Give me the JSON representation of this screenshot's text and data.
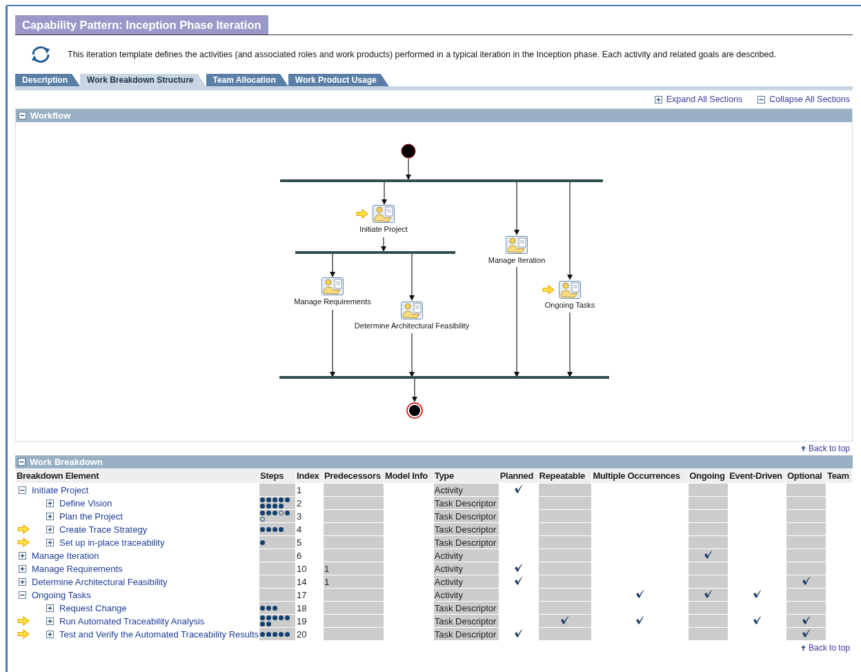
{
  "title": "Capability Pattern: Inception Phase Iteration",
  "description": "This iteration template defines the activities (and associated roles and work products) performed in a typical iteration in the Inception phase. Each activity and related goals are described.",
  "tabs": [
    {
      "label": "Description",
      "selected": false
    },
    {
      "label": "Work Breakdown Structure",
      "selected": true
    },
    {
      "label": "Team Allocation",
      "selected": false
    },
    {
      "label": "Work Product Usage",
      "selected": false
    }
  ],
  "section_links": [
    {
      "kind": "expand",
      "label": "Expand All Sections"
    },
    {
      "kind": "collapse",
      "label": "Collapse All Sections"
    }
  ],
  "workflow": {
    "title": "Workflow",
    "expanded": true,
    "nodes": [
      {
        "label": "Initiate Project",
        "highlighted": true
      },
      {
        "label": "Manage Iteration",
        "highlighted": false
      },
      {
        "label": "Ongoing Tasks",
        "highlighted": true
      },
      {
        "label": "Manage Requirements",
        "highlighted": false
      },
      {
        "label": "Determine Architectural Feasibility",
        "highlighted": false
      }
    ],
    "back_to_top": "Back to top"
  },
  "work_breakdown": {
    "title": "Work Breakdown",
    "expanded": true,
    "columns": [
      "Breakdown Element",
      "Steps",
      "Index",
      "Predecessors",
      "Model Info",
      "Type",
      "Planned",
      "Repeatable",
      "Multiple Occurrences",
      "Ongoing",
      "Event-Driven",
      "Optional",
      "Team"
    ],
    "rows": [
      {
        "name": "Initiate Project",
        "expanded": true,
        "highlighted": false,
        "steps": [],
        "index": "1",
        "type": "Activity",
        "planned": true,
        "repeatable": false,
        "multiple": false,
        "ongoing": false,
        "event_driven": false,
        "optional": false,
        "children": [
          {
            "name": "Define Vision",
            "expanded": false,
            "highlighted": false,
            "steps": [
              {
                "filled": true
              },
              {
                "filled": true
              },
              {
                "filled": true
              },
              {
                "filled": true
              },
              {
                "filled": true
              },
              {
                "filled": true
              },
              {
                "filled": true
              },
              {
                "filled": true
              },
              {
                "filled": true
              }
            ],
            "index": "2",
            "type": "Task Descriptor",
            "planned": false,
            "repeatable": false,
            "multiple": false,
            "ongoing": false,
            "event_driven": false,
            "optional": false
          },
          {
            "name": "Plan the Project",
            "expanded": false,
            "highlighted": false,
            "steps": [
              {
                "filled": true
              },
              {
                "filled": true
              },
              {
                "filled": true
              },
              {
                "filled": false
              },
              {
                "filled": true
              },
              {
                "filled": false
              }
            ],
            "index": "3",
            "type": "Task Descriptor",
            "planned": false,
            "repeatable": false,
            "multiple": false,
            "ongoing": false,
            "event_driven": false,
            "optional": false
          },
          {
            "name": "Create Trace Strategy",
            "expanded": false,
            "highlighted": true,
            "steps": [
              {
                "filled": true
              },
              {
                "filled": true
              },
              {
                "filled": true
              },
              {
                "filled": true
              }
            ],
            "index": "4",
            "type": "Task Descriptor",
            "planned": false,
            "repeatable": false,
            "multiple": false,
            "ongoing": false,
            "event_driven": false,
            "optional": false
          },
          {
            "name": "Set up in-place traceability",
            "expanded": false,
            "highlighted": true,
            "steps": [
              {
                "filled": true
              }
            ],
            "index": "5",
            "type": "Task Descriptor",
            "planned": false,
            "repeatable": false,
            "multiple": false,
            "ongoing": false,
            "event_driven": false,
            "optional": false
          }
        ]
      },
      {
        "name": "Manage Iteration",
        "expanded": false,
        "highlighted": false,
        "steps": [],
        "index": "6",
        "type": "Activity",
        "planned": false,
        "repeatable": false,
        "multiple": false,
        "ongoing": true,
        "event_driven": false,
        "optional": false
      },
      {
        "name": "Manage Requirements",
        "expanded": false,
        "highlighted": false,
        "steps": [],
        "index": "10",
        "predecessors": "1",
        "type": "Activity",
        "planned": true,
        "repeatable": false,
        "multiple": false,
        "ongoing": false,
        "event_driven": false,
        "optional": false
      },
      {
        "name": "Determine Architectural Feasibility",
        "expanded": false,
        "highlighted": false,
        "steps": [],
        "index": "14",
        "predecessors": "1",
        "type": "Activity",
        "planned": true,
        "repeatable": false,
        "multiple": false,
        "ongoing": false,
        "event_driven": false,
        "optional": true
      },
      {
        "name": "Ongoing Tasks",
        "expanded": true,
        "highlighted": false,
        "steps": [],
        "index": "17",
        "type": "Activity",
        "planned": false,
        "repeatable": false,
        "multiple": true,
        "ongoing": true,
        "event_driven": true,
        "optional": false,
        "children": [
          {
            "name": "Request Change",
            "expanded": false,
            "highlighted": false,
            "steps": [
              {
                "filled": true
              },
              {
                "filled": true
              },
              {
                "filled": true
              }
            ],
            "index": "18",
            "type": "Task Descriptor",
            "planned": false,
            "repeatable": false,
            "multiple": false,
            "ongoing": false,
            "event_driven": false,
            "optional": false
          },
          {
            "name": "Run Automated Traceability Analysis",
            "expanded": false,
            "highlighted": true,
            "steps": [
              {
                "filled": true
              },
              {
                "filled": true
              },
              {
                "filled": true
              },
              {
                "filled": true
              },
              {
                "filled": true
              },
              {
                "filled": true
              },
              {
                "filled": true
              }
            ],
            "index": "19",
            "type": "Task Descriptor",
            "planned": false,
            "repeatable": true,
            "multiple": true,
            "ongoing": false,
            "event_driven": true,
            "optional": true
          },
          {
            "name": "Test and Verify the Automated Traceability Results",
            "expanded": false,
            "highlighted": true,
            "steps": [
              {
                "filled": true
              },
              {
                "filled": true
              },
              {
                "filled": true
              },
              {
                "filled": true
              },
              {
                "filled": true
              }
            ],
            "index": "20",
            "type": "Task Descriptor",
            "planned": true,
            "repeatable": false,
            "multiple": false,
            "ongoing": false,
            "event_driven": false,
            "optional": true
          }
        ]
      }
    ],
    "back_to_top": "Back to top"
  }
}
